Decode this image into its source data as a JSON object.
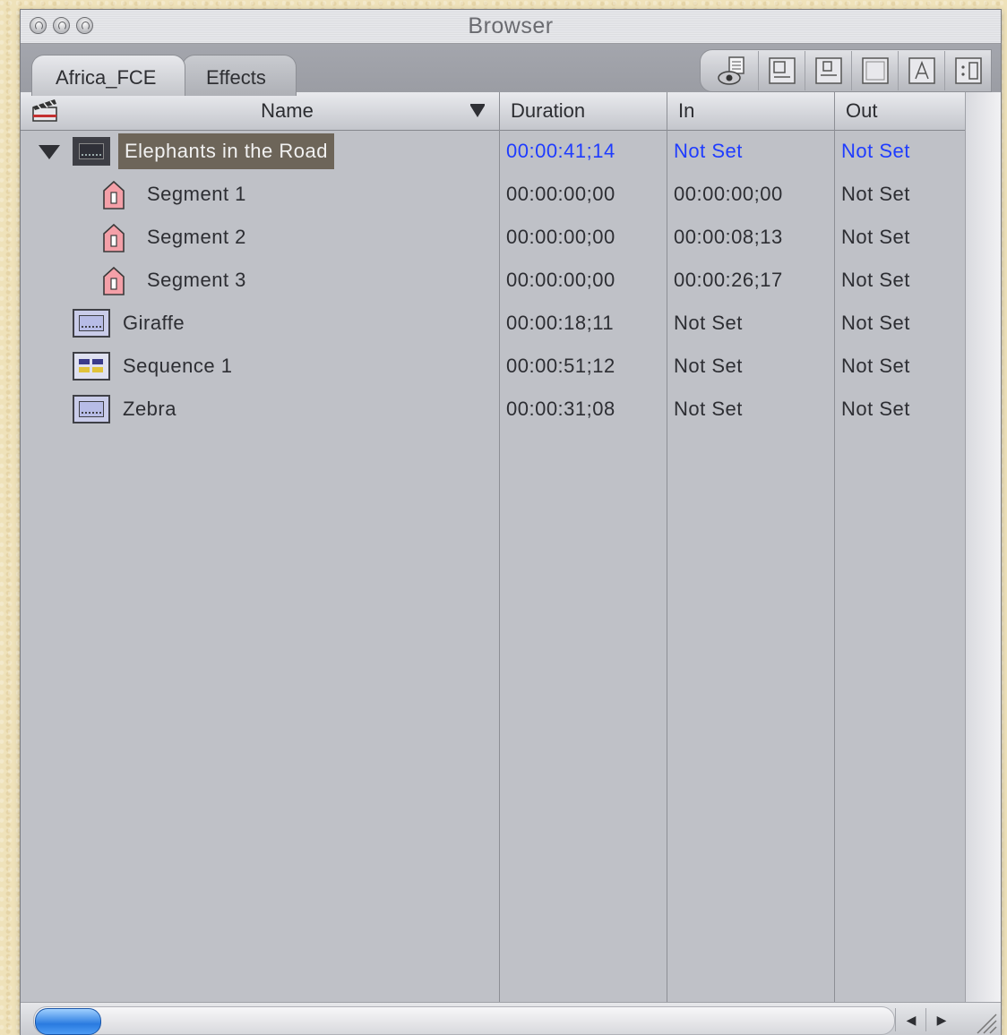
{
  "window": {
    "title": "Browser"
  },
  "tabs": [
    {
      "label": "Africa_FCE",
      "active": true
    },
    {
      "label": "Effects",
      "active": false
    }
  ],
  "toolbar": {
    "buttons": [
      {
        "icon": "view-eye-icon"
      },
      {
        "icon": "large-icons-icon"
      },
      {
        "icon": "medium-icons-icon"
      },
      {
        "icon": "list-view-icon"
      },
      {
        "icon": "text-view-icon"
      },
      {
        "icon": "settings-view-icon"
      }
    ]
  },
  "columns": {
    "name": "Name",
    "duration": "Duration",
    "in": "In",
    "out": "Out"
  },
  "rows": [
    {
      "name": "Elephants in the Road",
      "duration": "00:00:41;14",
      "in": "Not Set",
      "out": "Not Set",
      "icon": "clip-icon",
      "selected": true,
      "expanded": true,
      "level": 0
    },
    {
      "name": "Segment 1",
      "duration": "00:00:00;00",
      "in": "00:00:00;00",
      "out": "Not Set",
      "icon": "marker-icon",
      "level": 1
    },
    {
      "name": "Segment 2",
      "duration": "00:00:00;00",
      "in": "00:00:08;13",
      "out": "Not Set",
      "icon": "marker-icon",
      "level": 1
    },
    {
      "name": "Segment 3",
      "duration": "00:00:00;00",
      "in": "00:00:26;17",
      "out": "Not Set",
      "icon": "marker-icon",
      "level": 1
    },
    {
      "name": "Giraffe",
      "duration": "00:00:18;11",
      "in": "Not Set",
      "out": "Not Set",
      "icon": "clip-icon",
      "level": 0
    },
    {
      "name": "Sequence 1",
      "duration": "00:00:51;12",
      "in": "Not Set",
      "out": "Not Set",
      "icon": "sequence-icon",
      "level": 0
    },
    {
      "name": "Zebra",
      "duration": "00:00:31;08",
      "in": "Not Set",
      "out": "Not Set",
      "icon": "clip-icon",
      "level": 0
    }
  ],
  "colors": {
    "selected_text": "#1f3cff",
    "selection_bg": "#6d6559",
    "marker": "#f4a0a8",
    "scroll_thumb": "#2a7be0"
  }
}
